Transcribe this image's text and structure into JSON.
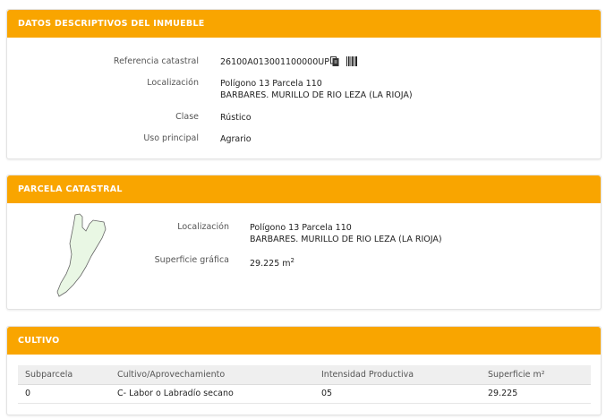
{
  "inmueble": {
    "title": "DATOS DESCRIPTIVOS DEL INMUEBLE",
    "ref_label": "Referencia catastral",
    "ref_value": "26100A013001100000UP",
    "loc_label": "Localización",
    "loc_line1": "Polígono 13 Parcela 110",
    "loc_line2": "BARBARES. MURILLO DE RIO LEZA (LA RIOJA)",
    "clase_label": "Clase",
    "clase_value": "Rústico",
    "uso_label": "Uso principal",
    "uso_value": "Agrario"
  },
  "parcela": {
    "title": "PARCELA CATASTRAL",
    "loc_label": "Localización",
    "loc_line1": "Polígono 13 Parcela 110",
    "loc_line2": "BARBARES. MURILLO DE RIO LEZA (LA RIOJA)",
    "sup_label": "Superficie gráfica",
    "sup_value": "29.225 m",
    "sup_unit_sup": "2"
  },
  "cultivo": {
    "title": "CULTIVO",
    "headers": {
      "subparcela": "Subparcela",
      "cultivo": "Cultivo/Aprovechamiento",
      "intensidad": "Intensidad Productiva",
      "superficie": "Superficie m²"
    },
    "rows": [
      {
        "subparcela": "0",
        "cultivo": "C- Labor o Labradío secano",
        "intensidad": "05",
        "superficie": "29.225"
      }
    ]
  },
  "colors": {
    "header_bg": "#f9a500",
    "parcel_fill": "#e9f7e4",
    "parcel_stroke": "#666666"
  },
  "icons": [
    "copy-icon",
    "barcode-icon"
  ]
}
